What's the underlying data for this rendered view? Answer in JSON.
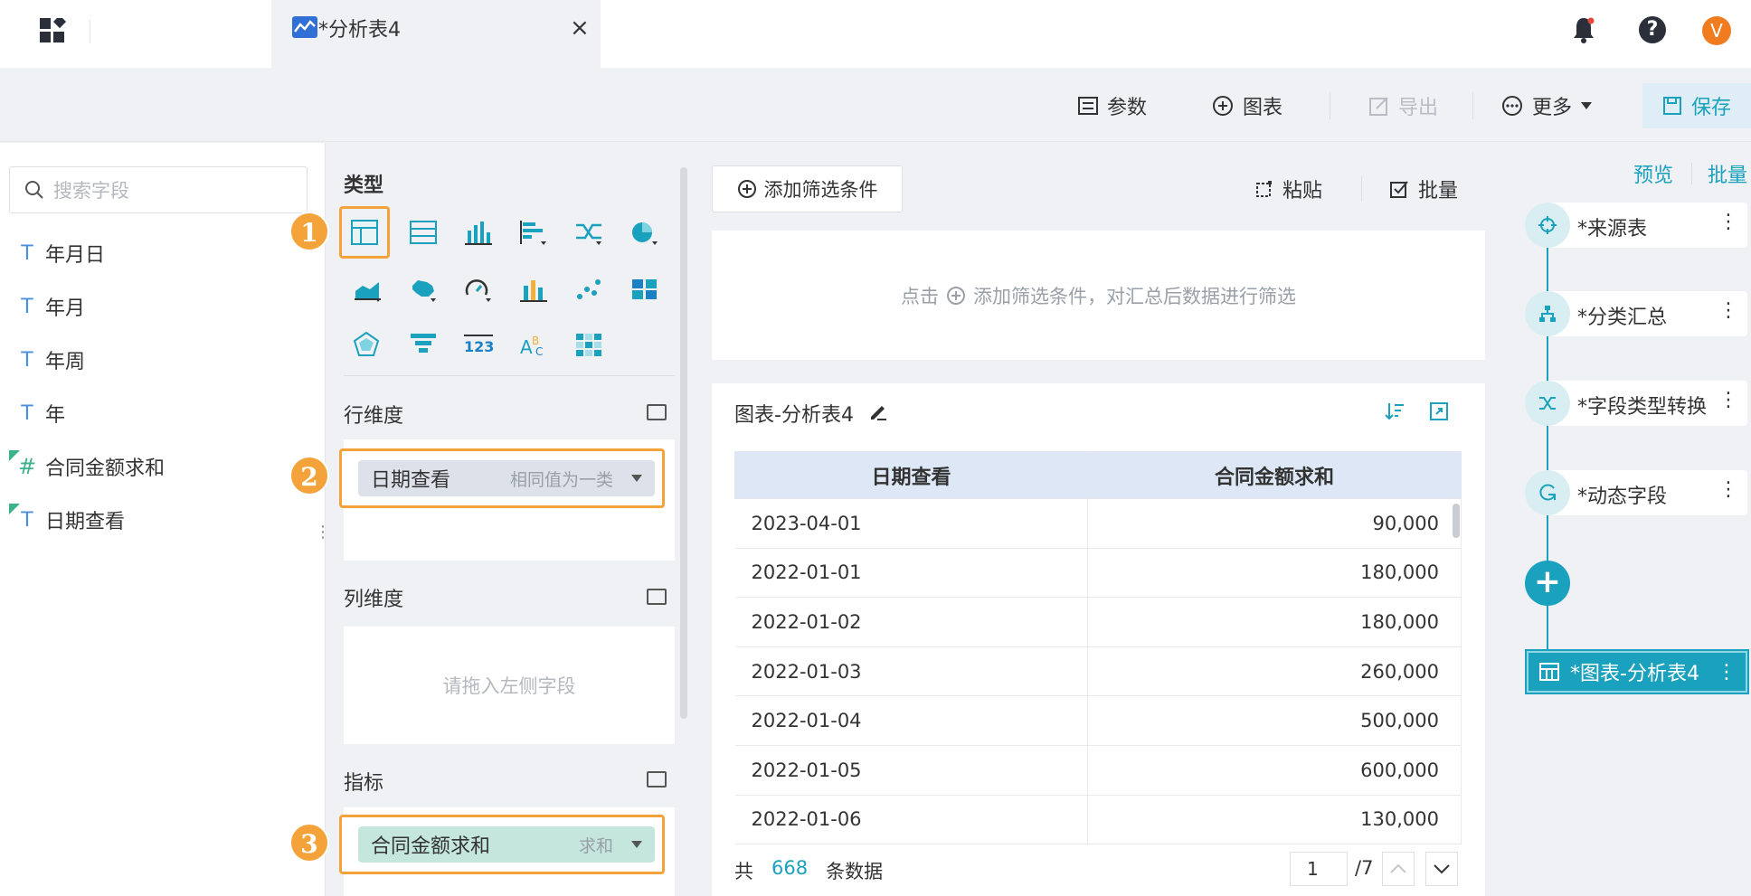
{
  "tab": {
    "title": "*分析表4"
  },
  "toolbar": {
    "params_label": "参数",
    "chart_label": "图表",
    "export_label": "导出",
    "more_label": "更多",
    "save_label": "保存"
  },
  "fields": {
    "search_placeholder": "搜索字段",
    "items": [
      {
        "label": "年月日",
        "type": "text"
      },
      {
        "label": "年月",
        "type": "text"
      },
      {
        "label": "年周",
        "type": "text"
      },
      {
        "label": "年",
        "type": "text"
      },
      {
        "label": "合同金额求和",
        "type": "number"
      },
      {
        "label": "日期查看",
        "type": "text"
      }
    ]
  },
  "config": {
    "type_title": "类型",
    "row_dim_title": "行维度",
    "col_dim_title": "列维度",
    "metric_title": "指标",
    "row_pill": {
      "label": "日期查看",
      "sub": "相同值为一类"
    },
    "col_placeholder": "请拖入左侧字段",
    "metric_pill": {
      "label": "合同金额求和",
      "sub": "求和"
    },
    "badges": [
      "1",
      "2",
      "3"
    ]
  },
  "filter": {
    "add_label": "添加筛选条件",
    "paste_label": "粘贴",
    "batch_label": "批量",
    "hint_prefix": "点击",
    "hint_text": "添加筛选条件，对汇总后数据进行筛选"
  },
  "chart_card": {
    "title": "图表-分析表4",
    "columns": [
      "日期查看",
      "合同金额求和"
    ],
    "rows": [
      [
        "2023-04-01",
        "90,000"
      ],
      [
        "2022-01-01",
        "180,000"
      ],
      [
        "2022-01-02",
        "180,000"
      ],
      [
        "2022-01-03",
        "260,000"
      ],
      [
        "2022-01-04",
        "500,000"
      ],
      [
        "2022-01-05",
        "600,000"
      ],
      [
        "2022-01-06",
        "130,000"
      ]
    ],
    "footer": {
      "prefix": "共",
      "count": "668",
      "suffix": "条数据",
      "page": "1",
      "total_pages": "/7"
    }
  },
  "pipeline": {
    "preview_label": "预览",
    "batch_label": "批量",
    "nodes": [
      {
        "label": "*来源表",
        "icon": "crosshair-icon"
      },
      {
        "label": "*分类汇总",
        "icon": "hierarchy-icon"
      },
      {
        "label": "*字段类型转换",
        "icon": "shuffle-icon"
      },
      {
        "label": "*动态字段",
        "icon": "formula-icon"
      }
    ],
    "chart_node": "*图表-分析表4"
  },
  "colors": {
    "accent": "#1aa1bd",
    "highlight": "#f3a33a",
    "avatar": "#f07c1f"
  },
  "user": {
    "avatar_letter": "V"
  }
}
